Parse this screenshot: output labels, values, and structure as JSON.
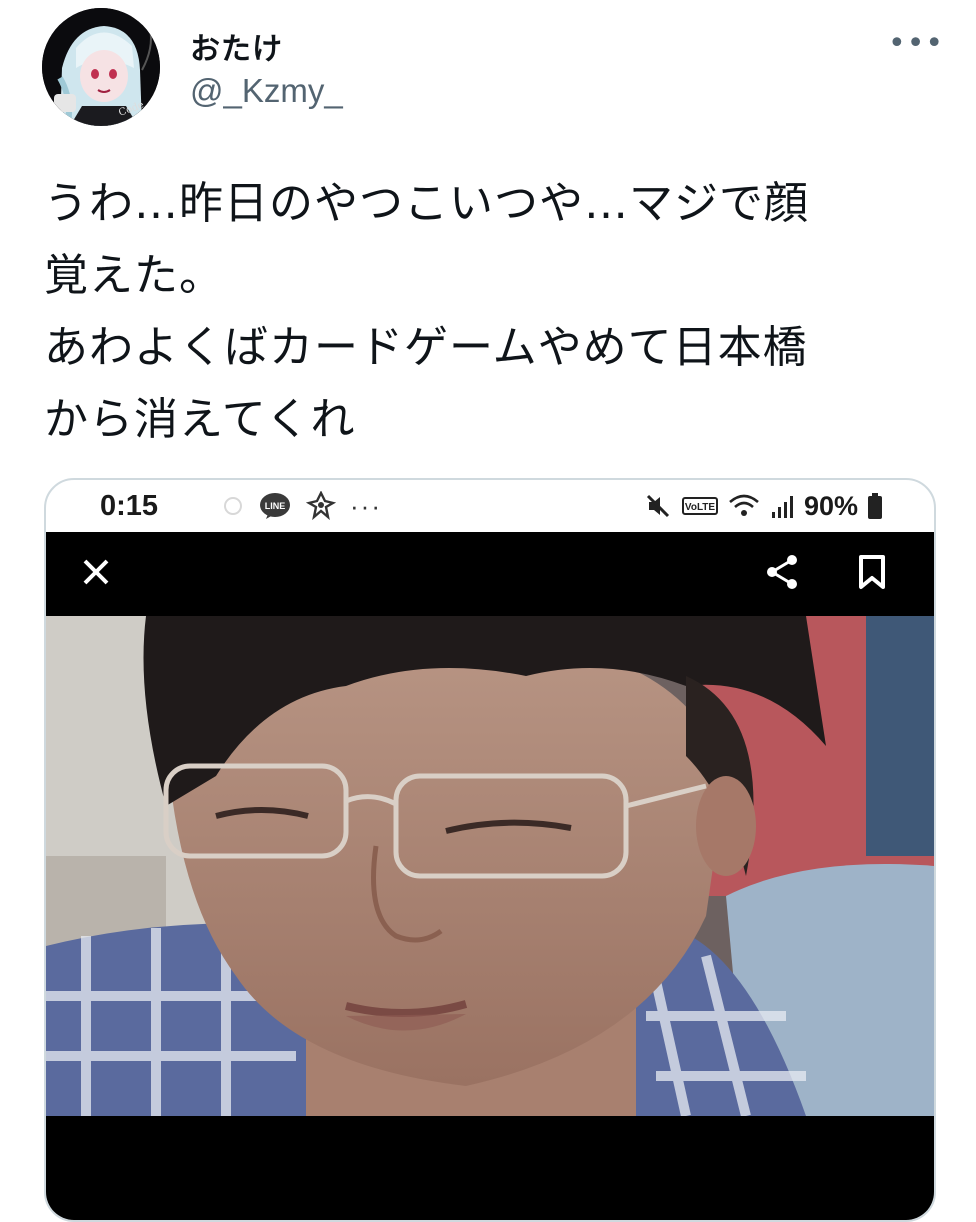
{
  "tweet": {
    "display_name": "おたけ",
    "handle": "@_Kzmy_",
    "more_label": "•••",
    "text_lines": [
      "うわ…昨日のやつこいつや…マジで顔",
      "覚えた。",
      "あわよくばカードゲームやめて日本橋",
      "から消えてくれ"
    ]
  },
  "screenshot": {
    "status_bar": {
      "time": "0:15",
      "line_badge": "LINE",
      "lte_badge": "VoLTE",
      "battery": "90%",
      "more": "···"
    },
    "viewer": {
      "close_icon": "close-icon",
      "share_icon": "share-icon",
      "bookmark_icon": "bookmark-icon"
    },
    "photo_description_icon": "photo"
  },
  "colors": {
    "text": "#0f1419",
    "secondary": "#536471",
    "border": "#cfd9de",
    "viewer_bg": "#000000"
  }
}
